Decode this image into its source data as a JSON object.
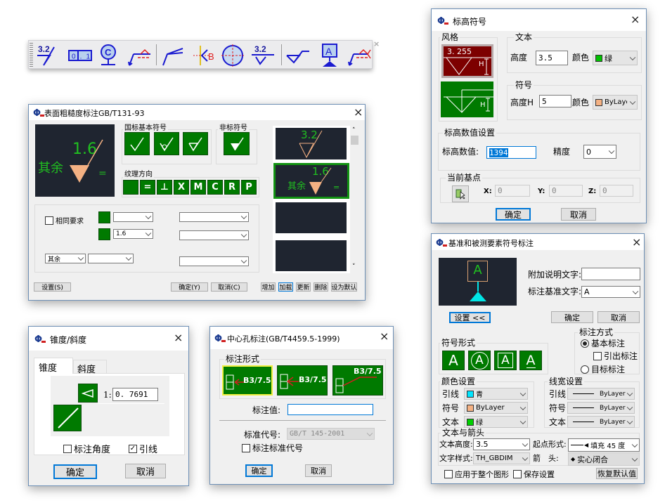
{
  "toolbar": {
    "icons": [
      "roughness-3.2-icon",
      "geometric-tolerance-icon",
      "datum-target-icon",
      "leader-weld-icon",
      "leader-icon",
      "datum-b-icon",
      "center-hole-icon",
      "roughness-underline-icon",
      "weld-symbol-icon",
      "datum-a-icon",
      "leader-weld-flag-icon"
    ],
    "roughness_text": "3.2",
    "tol_text": "0.1",
    "circle_letter": "C",
    "datum_letter": "B",
    "datum_a_letter": "A",
    "close": "×"
  },
  "surface": {
    "title": "表面粗糙度标注GB/T131-93",
    "close": "×",
    "preview": {
      "value": "1.6",
      "prefix": "其余",
      "suffix": "="
    },
    "group_basic": "国标基本符号",
    "group_nonstd": "非标符号",
    "group_texture": "纹理方向",
    "texture": [
      "",
      "=",
      "⊥",
      "X",
      "M",
      "C",
      "R",
      "P"
    ],
    "same_req": "相同要求",
    "combo2": "1.6",
    "combo_rest": "其余",
    "buttons": {
      "settings": "设置(S)",
      "ok": "确定(Y)",
      "cancel": "取消(C)",
      "add": "增加",
      "load": "加载",
      "update": "更新",
      "delete": "删除",
      "default": "设为默认"
    },
    "list": [
      {
        "value": "3.2"
      },
      {
        "value": "1.6",
        "prefix": "其余",
        "suffix": "="
      }
    ]
  },
  "elev": {
    "title": "标高符号",
    "close": "×",
    "style": "风格",
    "style_value": "3. 255",
    "h": "H",
    "text_group": "文本",
    "height_label": "高度",
    "height": "3.5",
    "color_label": "颜色",
    "text_color": "绿",
    "text_color_hex": "#00c000",
    "sym_group": "符号",
    "sym_height_label": "高度H",
    "sym_height": "5",
    "sym_color": "ByLayer",
    "sym_color_hex": "#f4b183",
    "value_group": "标高数值设置",
    "value_label": "标高数值:",
    "value": "1394",
    "precision_label": "精度",
    "precision": "0",
    "base_group": "当前基点",
    "x_label": "X:",
    "x": "0",
    "y_label": "Y:",
    "y": "0",
    "z_label": "Z:",
    "z": "0",
    "ok": "确定",
    "cancel": "取消"
  },
  "datum": {
    "title": "基准和被测要素符号标注",
    "close": "×",
    "preview_letter": "A",
    "extra_label": "附加说明文字:",
    "extra": "",
    "datum_label": "标注基准文字:",
    "datum": "A",
    "settings": "设置 <<",
    "ok": "确定",
    "cancel": "取消",
    "mode_group": "标注方式",
    "mode_basic": "基本标注",
    "mode_leader": "引出标注",
    "mode_target": "目标标注",
    "form_group": "符号形式",
    "form_letter": "A",
    "color_group": "颜色设置",
    "width_group": "线宽设置",
    "rows": [
      {
        "label": "引线",
        "color": "青",
        "hex": "#00e5ff",
        "width": "ByLayer"
      },
      {
        "label": "符号",
        "color": "ByLayer",
        "hex": "#f4b183",
        "width": "ByLayer"
      },
      {
        "label": "文本",
        "color": "绿",
        "hex": "#00d000",
        "width": "ByLayer"
      }
    ],
    "ta_group": "文本与箭头",
    "text_height_label": "文本高度:",
    "text_height": "3.5",
    "start_label": "起点形式:",
    "start": "填充 45 度",
    "style_label": "文字样式:",
    "style": "TH_GBDIM",
    "arrow_label": "箭　头:",
    "arrow": "实心闭合",
    "apply_all": "应用于整个图形",
    "save": "保存设置",
    "restore": "恢复默认值"
  },
  "taper": {
    "title": "锥度/斜度",
    "close": "×",
    "tab_taper": "锥度",
    "tab_slope": "斜度",
    "ratio_label": "1:",
    "ratio": "0. 7691",
    "angle": "标注角度",
    "leader": "引线",
    "ok": "确定",
    "cancel": "取消"
  },
  "center": {
    "title": "中心孔标注(GB/T4459.5-1999)",
    "close": "×",
    "form_group": "标注形式",
    "form_text": "B3/7.5",
    "value_label": "标注值:",
    "value": "",
    "std_label": "标准代号:",
    "std": "GB/T 145-2001",
    "show_std": "标注标准代号",
    "ok": "确定",
    "cancel": "取消"
  }
}
